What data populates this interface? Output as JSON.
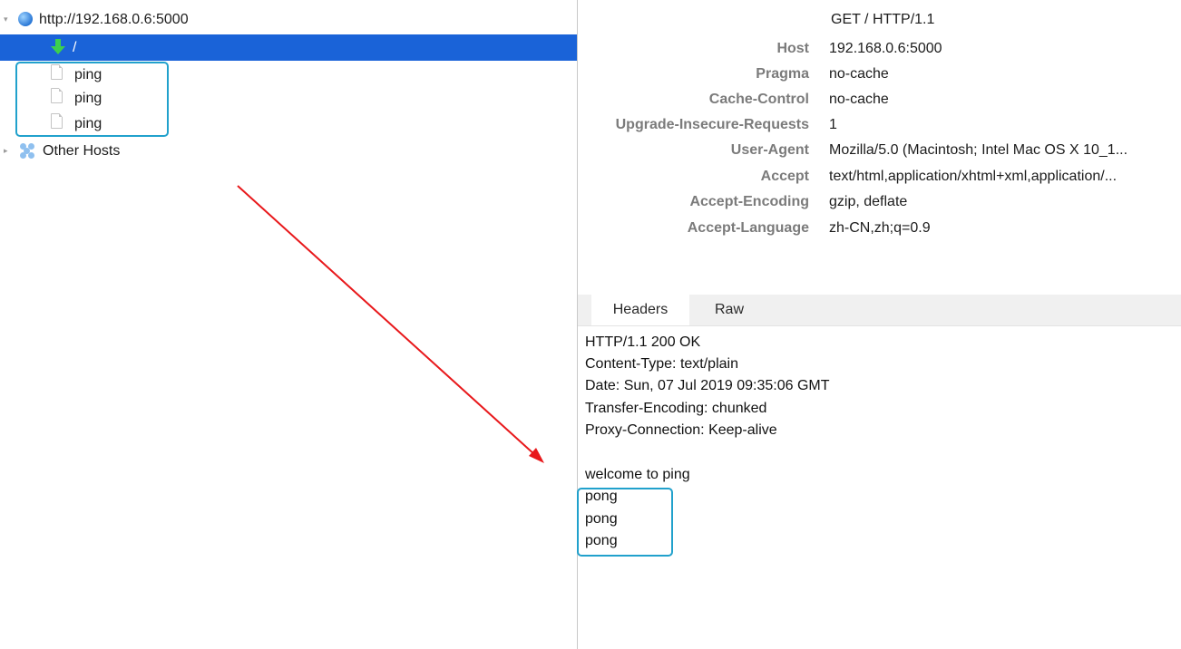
{
  "tree": {
    "host": {
      "url": "http://192.168.0.6:5000"
    },
    "root_path": "/",
    "pings": [
      "ping",
      "ping",
      "ping"
    ],
    "other_hosts": "Other Hosts"
  },
  "request": {
    "request_line": "GET / HTTP/1.1",
    "headers": [
      {
        "key": "Host",
        "value": "192.168.0.6:5000"
      },
      {
        "key": "Pragma",
        "value": "no-cache"
      },
      {
        "key": "Cache-Control",
        "value": "no-cache"
      },
      {
        "key": "Upgrade-Insecure-Requests",
        "value": "1"
      },
      {
        "key": "User-Agent",
        "value": "Mozilla/5.0 (Macintosh; Intel Mac OS X 10_1..."
      },
      {
        "key": "Accept",
        "value": "text/html,application/xhtml+xml,application/..."
      },
      {
        "key": "Accept-Encoding",
        "value": "gzip, deflate"
      },
      {
        "key": "Accept-Language",
        "value": "zh-CN,zh;q=0.9"
      }
    ]
  },
  "tabs": [
    "Headers",
    "Raw"
  ],
  "response": {
    "lines": [
      "HTTP/1.1 200 OK",
      "Content-Type: text/plain",
      "Date: Sun, 07 Jul 2019 09:35:06 GMT",
      "Transfer-Encoding: chunked",
      "Proxy-Connection: Keep-alive"
    ],
    "body": [
      "welcome to ping",
      "pong",
      "pong",
      "pong"
    ]
  },
  "colors": {
    "selection": "#1a63d8",
    "highlight_box": "#21a1cc",
    "annotation_arrow": "#e8181b",
    "header_key": "#7b7b7b"
  }
}
